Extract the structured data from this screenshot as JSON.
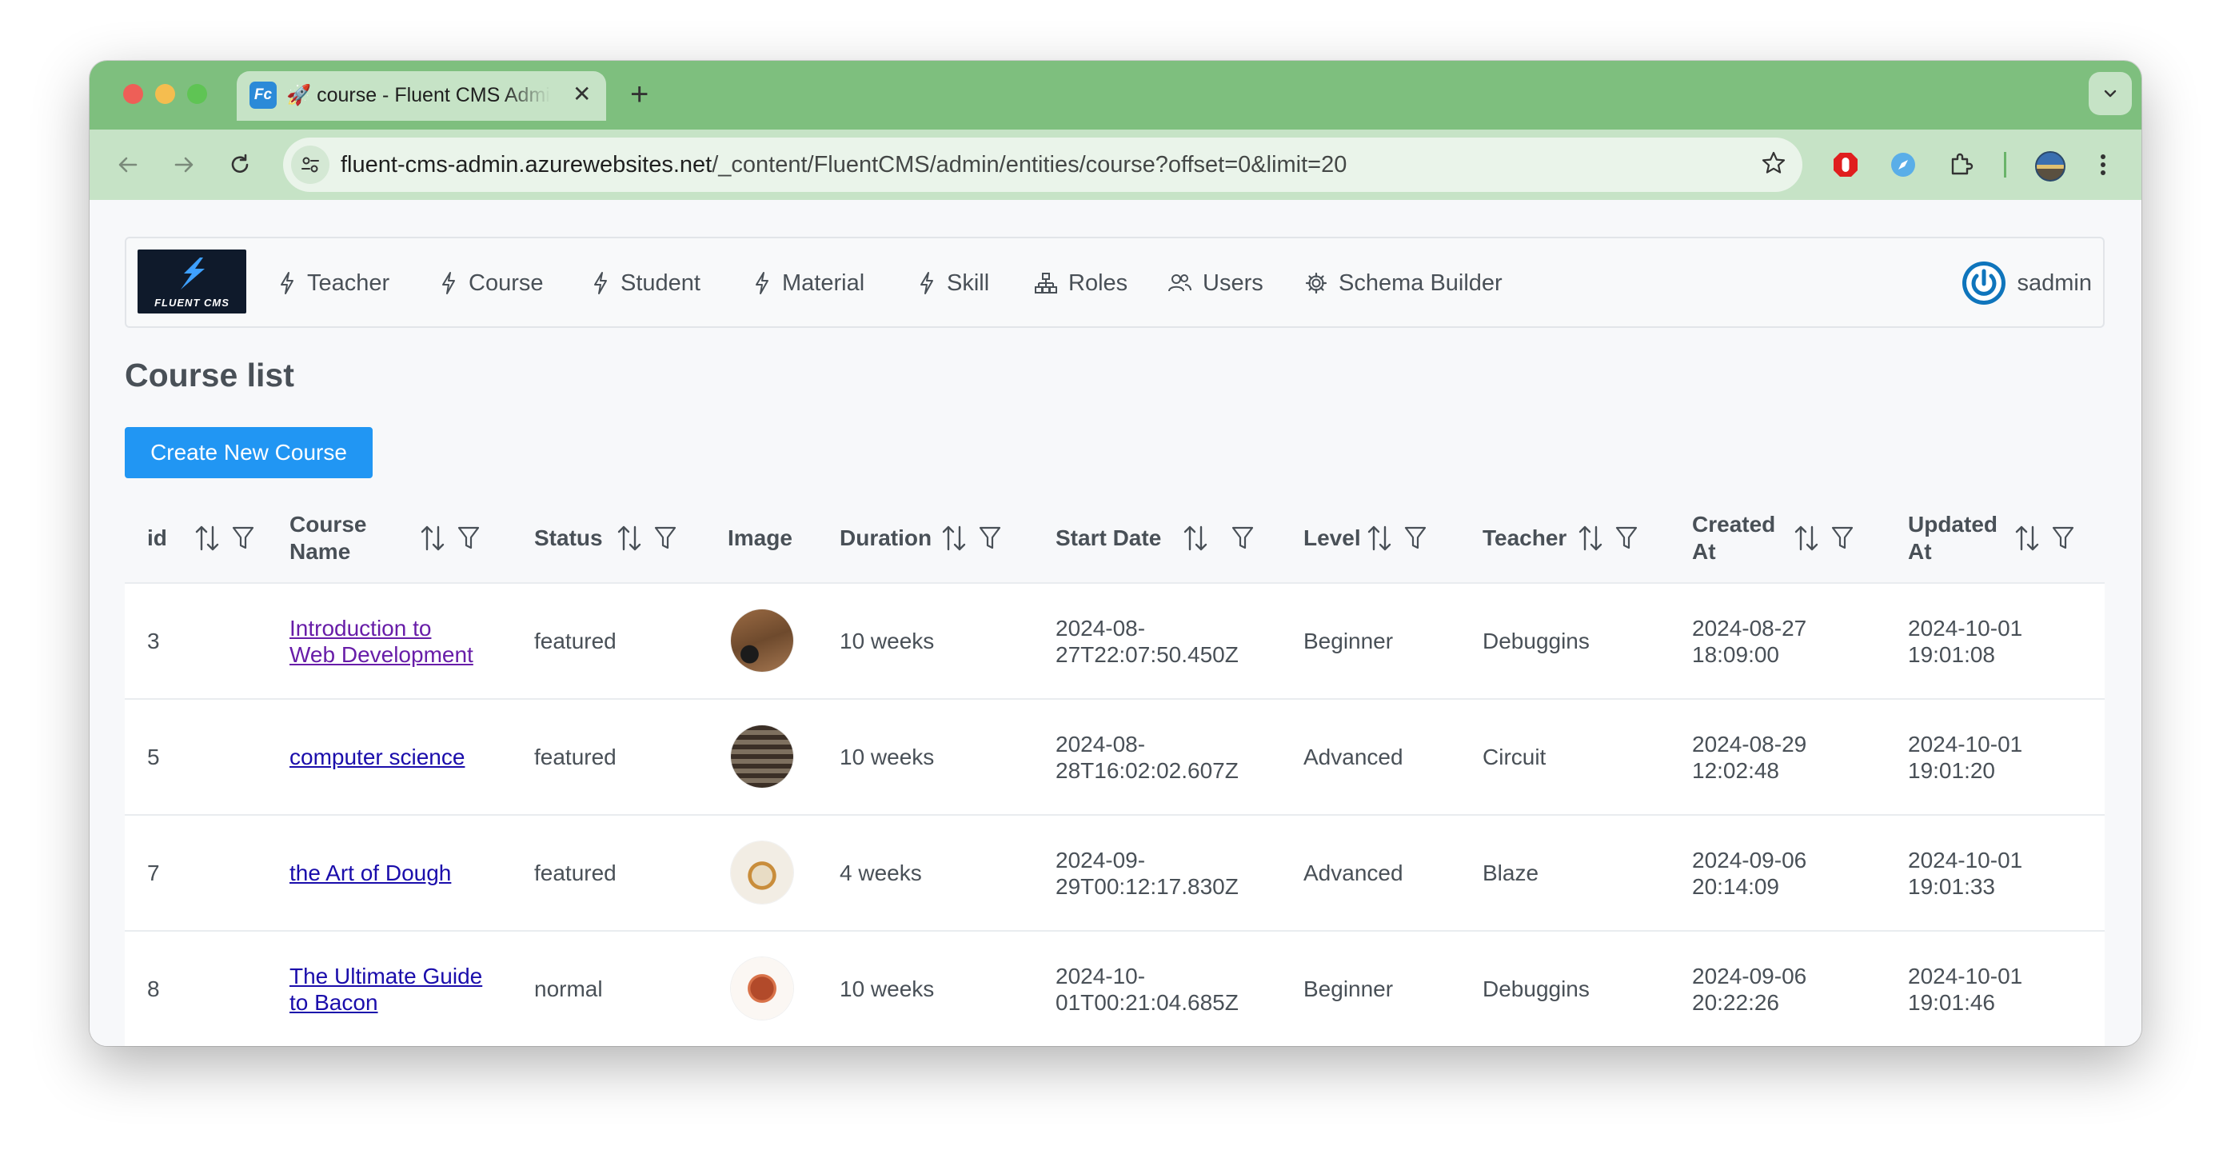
{
  "browser": {
    "tab": {
      "favicon_text": "Fc",
      "title": "🚀 course - Fluent CMS Admin"
    },
    "url": {
      "host": "fluent-cms-admin.azurewebsites.net",
      "path": "/_content/FluentCMS/admin/entities/course?offset=0&limit=20"
    }
  },
  "app": {
    "logo_text": "FLUENT CMS",
    "menu": [
      {
        "label": "Teacher",
        "icon": "bolt-icon"
      },
      {
        "label": "Course",
        "icon": "bolt-icon"
      },
      {
        "label": "Student",
        "icon": "bolt-icon"
      },
      {
        "label": "Material",
        "icon": "bolt-icon"
      },
      {
        "label": "Skill",
        "icon": "bolt-icon"
      },
      {
        "label": "Roles",
        "icon": "sitemap-icon"
      },
      {
        "label": "Users",
        "icon": "users-icon"
      },
      {
        "label": "Schema Builder",
        "icon": "cog-icon"
      }
    ],
    "user": {
      "name": "sadmin",
      "icon": "power-icon"
    }
  },
  "page": {
    "title": "Course list",
    "create_button": "Create New Course"
  },
  "table": {
    "columns": [
      {
        "line1": "id",
        "line2": ""
      },
      {
        "line1": "Course",
        "line2": "Name"
      },
      {
        "line1": "Status",
        "line2": ""
      },
      {
        "line1": "Image",
        "line2": ""
      },
      {
        "line1": "Duration",
        "line2": ""
      },
      {
        "line1": "Start Date",
        "line2": ""
      },
      {
        "line1": "Level",
        "line2": ""
      },
      {
        "line1": "Teacher",
        "line2": ""
      },
      {
        "line1": "Created",
        "line2": "At"
      },
      {
        "line1": "Updated",
        "line2": "At"
      }
    ],
    "rows": [
      {
        "id": "3",
        "name_line1": "Introduction to",
        "name_line2": "Web Development",
        "status": "featured",
        "image": "course-thumbnail",
        "duration": "10 weeks",
        "start_line1": "2024-08-",
        "start_line2": "27T22:07:50.450Z",
        "level": "Beginner",
        "teacher": "Debuggins",
        "created_line1": "2024-08-27",
        "created_line2": "18:09:00",
        "updated_line1": "2024-10-01",
        "updated_line2": "19:01:08"
      },
      {
        "id": "5",
        "name_line1": "computer science",
        "name_line2": "",
        "status": "featured",
        "image": "course-thumbnail",
        "duration": "10 weeks",
        "start_line1": "2024-08-",
        "start_line2": "28T16:02:02.607Z",
        "level": "Advanced",
        "teacher": "Circuit",
        "created_line1": "2024-08-29",
        "created_line2": "12:02:48",
        "updated_line1": "2024-10-01",
        "updated_line2": "19:01:20"
      },
      {
        "id": "7",
        "name_line1": "the Art of Dough",
        "name_line2": "",
        "status": "featured",
        "image": "course-thumbnail",
        "duration": "4 weeks",
        "start_line1": "2024-09-",
        "start_line2": "29T00:12:17.830Z",
        "level": "Advanced",
        "teacher": "Blaze",
        "created_line1": "2024-09-06",
        "created_line2": "20:14:09",
        "updated_line1": "2024-10-01",
        "updated_line2": "19:01:33"
      },
      {
        "id": "8",
        "name_line1": "The Ultimate Guide",
        "name_line2": "to Bacon",
        "status": "normal",
        "image": "course-thumbnail",
        "duration": "10 weeks",
        "start_line1": "2024-10-",
        "start_line2": "01T00:21:04.685Z",
        "level": "Beginner",
        "teacher": "Debuggins",
        "created_line1": "2024-09-06",
        "created_line2": "20:22:26",
        "updated_line1": "2024-10-01",
        "updated_line2": "19:01:46"
      }
    ]
  },
  "colors": {
    "browser_frame": "#7ebf7e",
    "toolbar": "#c6e3c6",
    "primary_button": "#2196f3",
    "link": "#1a0dab",
    "visited_link": "#681da8",
    "text": "#495057"
  }
}
